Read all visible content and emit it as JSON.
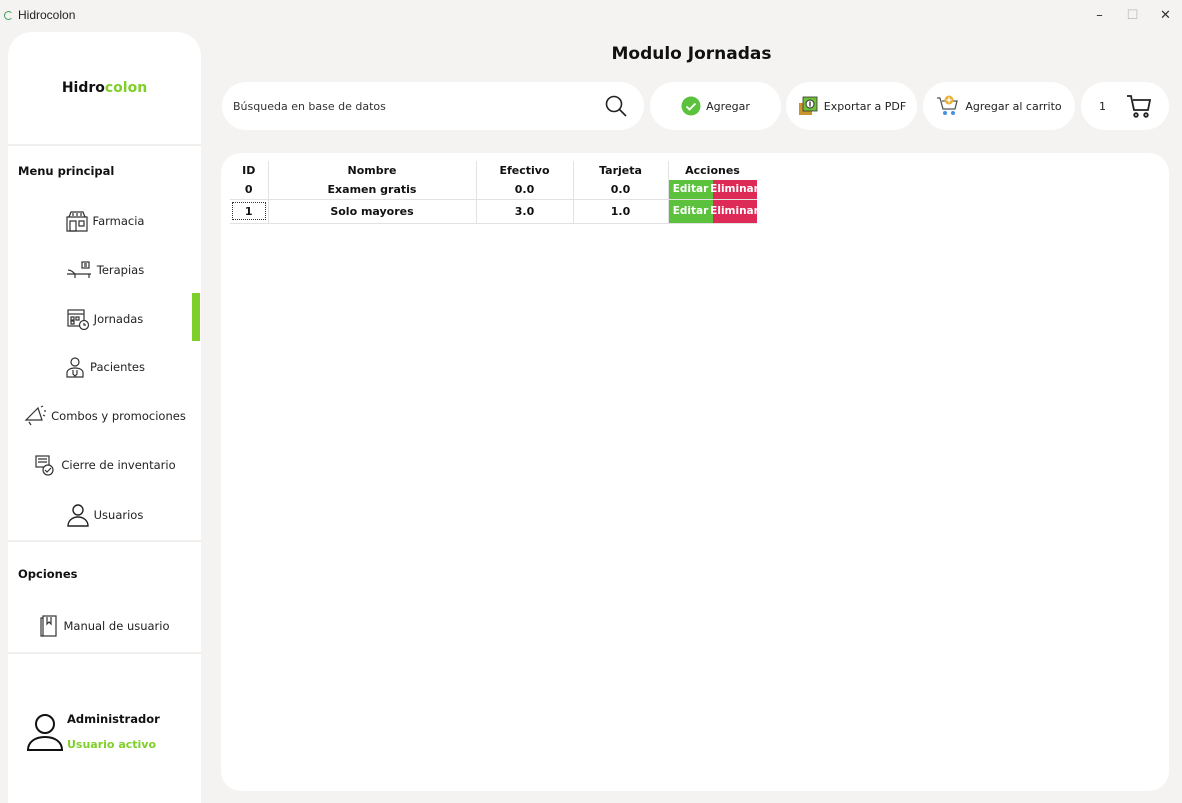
{
  "window": {
    "title": "Hidrocolon",
    "controls": {
      "minimize": "–",
      "maximize": "☐",
      "close": "✕"
    }
  },
  "sidebar": {
    "brand": {
      "part1": "Hidro",
      "part2": "colon"
    },
    "menu_label": "Menu principal",
    "items": [
      {
        "label": "Farmacia",
        "icon": "pharmacy-icon"
      },
      {
        "label": "Terapias",
        "icon": "therapy-bed-icon"
      },
      {
        "label": "Jornadas",
        "icon": "calendar-clock-icon",
        "active": true
      },
      {
        "label": "Pacientes",
        "icon": "patient-icon"
      },
      {
        "label": "Combos y promociones",
        "icon": "megaphone-icon"
      },
      {
        "label": "Cierre de inventario",
        "icon": "inventory-close-icon"
      },
      {
        "label": "Usuarios",
        "icon": "user-icon"
      }
    ],
    "options_label": "Opciones",
    "options": [
      {
        "label": "Manual de usuario",
        "icon": "manual-book-icon"
      }
    ],
    "user": {
      "name": "Administrador",
      "status": "Usuario activo"
    }
  },
  "main": {
    "title": "Modulo Jornadas",
    "search": {
      "placeholder": "Búsqueda en base de datos"
    },
    "toolbar": {
      "add_label": "Agregar",
      "pdf_label": "Exportar a PDF",
      "cart_label": "Agregar al carrito",
      "cart_count": "1"
    },
    "table": {
      "headers": [
        "ID",
        "Nombre",
        "Efectivo",
        "Tarjeta",
        "Acciones"
      ],
      "edit_label": "Editar",
      "delete_label": "Eliminar",
      "rows": [
        {
          "id": "0",
          "nombre": "Examen gratis",
          "efectivo": "0.0",
          "tarjeta": "0.0"
        },
        {
          "id": "1",
          "nombre": "Solo mayores",
          "efectivo": "3.0",
          "tarjeta": "1.0"
        }
      ]
    }
  },
  "colors": {
    "accent_green": "#7fcf2a",
    "edit_green": "#5cc23e",
    "delete_red": "#de2a56",
    "background": "#f4f3f2",
    "panel": "#ffffff"
  }
}
